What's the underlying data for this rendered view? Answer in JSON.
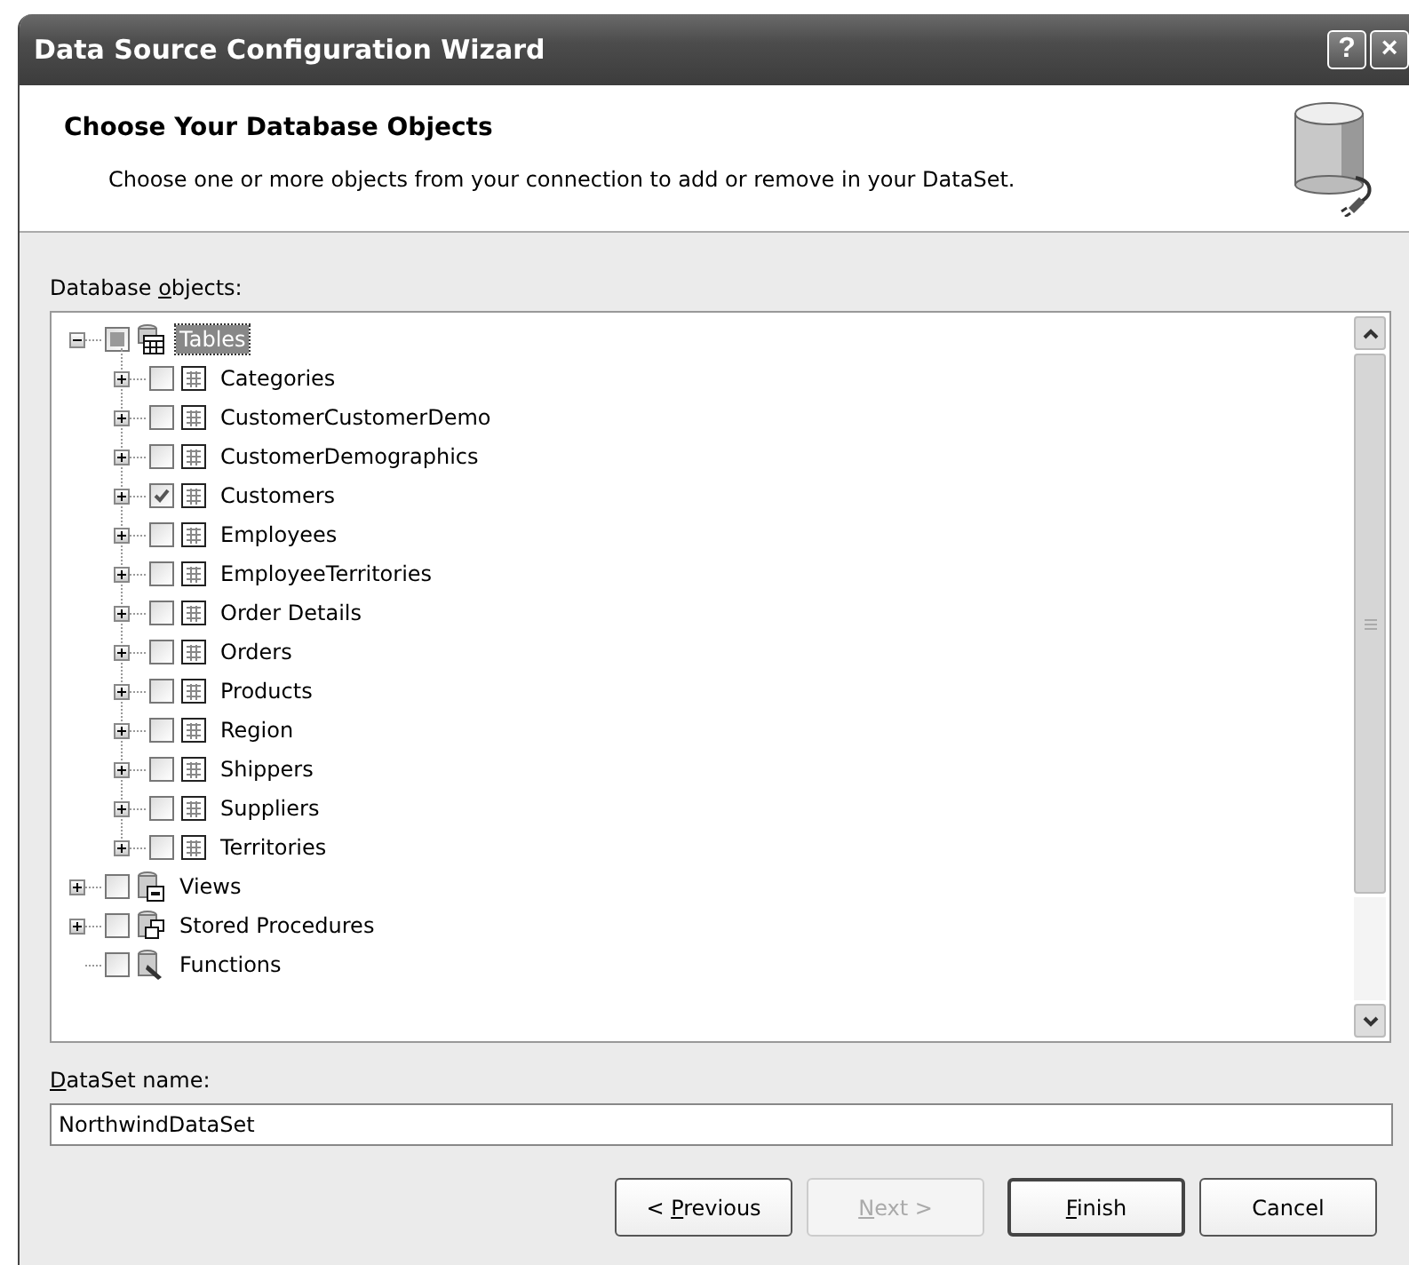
{
  "window": {
    "title": "Data Source Configuration Wizard",
    "title_buttons": [
      "?",
      "×"
    ]
  },
  "header": {
    "title": "Choose Your Database Objects",
    "description": "Choose one or more objects from your connection to add or remove in your DataSet."
  },
  "objects_label": {
    "before": "Database ",
    "access_key": "o",
    "after": "bjects:"
  },
  "tree": [
    {
      "label": "Tables",
      "kind": "tables",
      "checked": false,
      "indeterminate": true,
      "expanded": true,
      "selected": true,
      "children": [
        {
          "label": "Categories",
          "kind": "table",
          "checked": false,
          "expanded": false,
          "selected": false
        },
        {
          "label": "CustomerCustomerDemo",
          "kind": "table",
          "checked": false,
          "expanded": false,
          "selected": false
        },
        {
          "label": "CustomerDemographics",
          "kind": "table",
          "checked": false,
          "expanded": false,
          "selected": false
        },
        {
          "label": "Customers",
          "kind": "table",
          "checked": true,
          "expanded": false,
          "selected": false
        },
        {
          "label": "Employees",
          "kind": "table",
          "checked": false,
          "expanded": false,
          "selected": false
        },
        {
          "label": "EmployeeTerritories",
          "kind": "table",
          "checked": false,
          "expanded": false,
          "selected": false
        },
        {
          "label": "Order Details",
          "kind": "table",
          "checked": false,
          "expanded": false,
          "selected": false
        },
        {
          "label": "Orders",
          "kind": "table",
          "checked": false,
          "expanded": false,
          "selected": false
        },
        {
          "label": "Products",
          "kind": "table",
          "checked": false,
          "expanded": false,
          "selected": false
        },
        {
          "label": "Region",
          "kind": "table",
          "checked": false,
          "expanded": false,
          "selected": false
        },
        {
          "label": "Shippers",
          "kind": "table",
          "checked": false,
          "expanded": false,
          "selected": false
        },
        {
          "label": "Suppliers",
          "kind": "table",
          "checked": false,
          "expanded": false,
          "selected": false
        },
        {
          "label": "Territories",
          "kind": "table",
          "checked": false,
          "expanded": false,
          "selected": false
        }
      ]
    },
    {
      "label": "Views",
      "kind": "views",
      "checked": false,
      "expanded": false,
      "selected": false
    },
    {
      "label": "Stored Procedures",
      "kind": "procedures",
      "checked": false,
      "expanded": false,
      "selected": false
    },
    {
      "label": "Functions",
      "kind": "functions",
      "checked": false,
      "selected": false
    }
  ],
  "dataset_label": {
    "access_key": "D",
    "after": "ataSet name:"
  },
  "dataset_name": {
    "value": "NorthwindDataSet"
  },
  "buttons": [
    {
      "label": {
        "before": "< ",
        "access_key": "P",
        "after": "revious"
      },
      "disabled": false,
      "default": false
    },
    {
      "label": {
        "access_key": "N",
        "after": "ext >"
      },
      "disabled": true,
      "default": false
    },
    {
      "label": {
        "access_key": "F",
        "after": "inish"
      },
      "disabled": false,
      "default": true
    },
    {
      "label": {
        "before": "Cancel"
      },
      "disabled": false,
      "default": false
    }
  ]
}
